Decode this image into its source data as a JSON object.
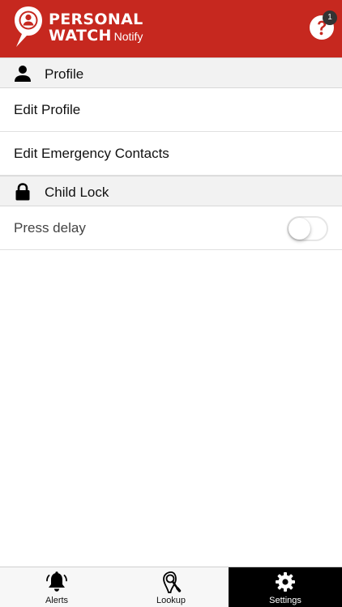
{
  "header": {
    "logo_line1": "PERSONAL",
    "logo_line2": "WATCH",
    "logo_suffix": "Notify",
    "help_icon": "question-circle-icon",
    "badge_count": "1",
    "brand_color": "#c6281f"
  },
  "sections": {
    "profile": {
      "label": "Profile",
      "icon": "person-icon"
    },
    "child_lock": {
      "label": "Child Lock",
      "icon": "lock-icon"
    }
  },
  "rows": {
    "edit_profile": "Edit Profile",
    "edit_emergency_contacts": "Edit Emergency Contacts",
    "press_delay": "Press delay",
    "press_delay_enabled": false
  },
  "tabs": [
    {
      "label": "Alerts",
      "icon": "bell-icon",
      "active": false
    },
    {
      "label": "Lookup",
      "icon": "pin-magnifier-icon",
      "active": false
    },
    {
      "label": "Settings",
      "icon": "gear-icon",
      "active": true
    }
  ]
}
